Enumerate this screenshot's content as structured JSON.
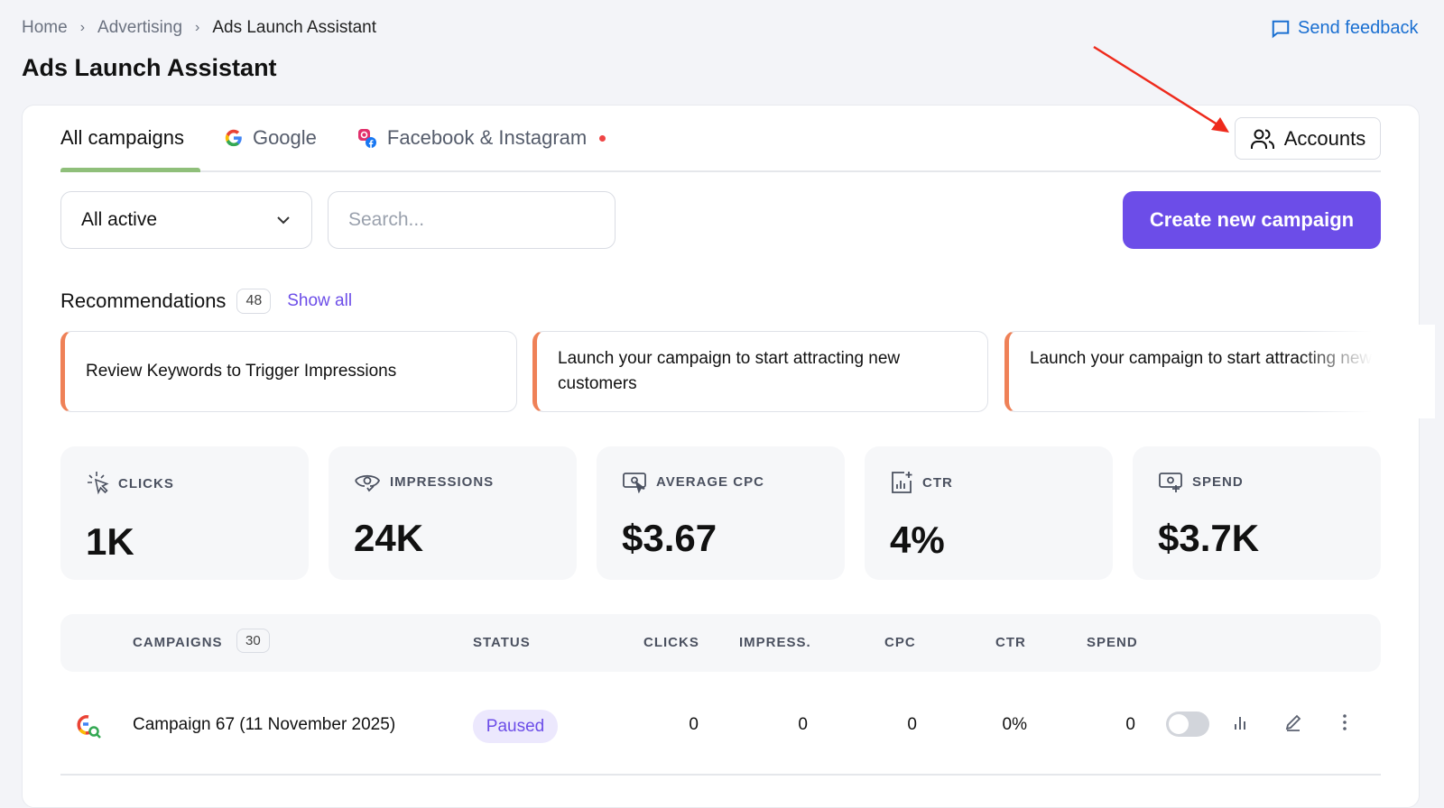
{
  "breadcrumb": [
    "Home",
    "Advertising",
    "Ads Launch Assistant"
  ],
  "page_title": "Ads Launch Assistant",
  "feedback_label": "Send feedback",
  "tabs": [
    {
      "label": "All campaigns",
      "active": true
    },
    {
      "label": "Google"
    },
    {
      "label": "Facebook & Instagram",
      "notification_dot": true
    }
  ],
  "accounts_label": "Accounts",
  "filter": {
    "selected": "All active"
  },
  "search": {
    "placeholder": "Search..."
  },
  "create_label": "Create new campaign",
  "recommendations": {
    "title": "Recommendations",
    "count": "48",
    "show_all": "Show all",
    "items": [
      "Review Keywords to Trigger Impressions",
      "Launch your campaign to start attracting new customers",
      "Launch your campaign to start attracting new customers"
    ]
  },
  "stats": [
    {
      "label": "CLICKS",
      "value": "1K",
      "icon": "cursor-click-icon"
    },
    {
      "label": "IMPRESSIONS",
      "value": "24K",
      "icon": "eye-icon"
    },
    {
      "label": "AVERAGE CPC",
      "value": "$3.67",
      "icon": "money-cursor-icon"
    },
    {
      "label": "CTR",
      "value": "4%",
      "icon": "chart-icon"
    },
    {
      "label": "SPEND",
      "value": "$3.7K",
      "icon": "money-plus-icon"
    }
  ],
  "table": {
    "headers": {
      "campaigns": "CAMPAIGNS",
      "count": "30",
      "status": "STATUS",
      "clicks": "CLICKS",
      "impressions": "IMPRESS.",
      "cpc": "CPC",
      "ctr": "CTR",
      "spend": "SPEND"
    },
    "rows": [
      {
        "name": "Campaign 67 (11 November 2025)",
        "status": "Paused",
        "clicks": "0",
        "impressions": "0",
        "cpc": "0",
        "ctr": "0%",
        "spend": "0",
        "enabled": false
      }
    ]
  },
  "colors": {
    "accent": "#6c4de8",
    "tab_active": "#8fbf7a",
    "rec_border": "#ef8157",
    "link": "#1a6fd1",
    "annotation_arrow": "#ee2a1c"
  }
}
